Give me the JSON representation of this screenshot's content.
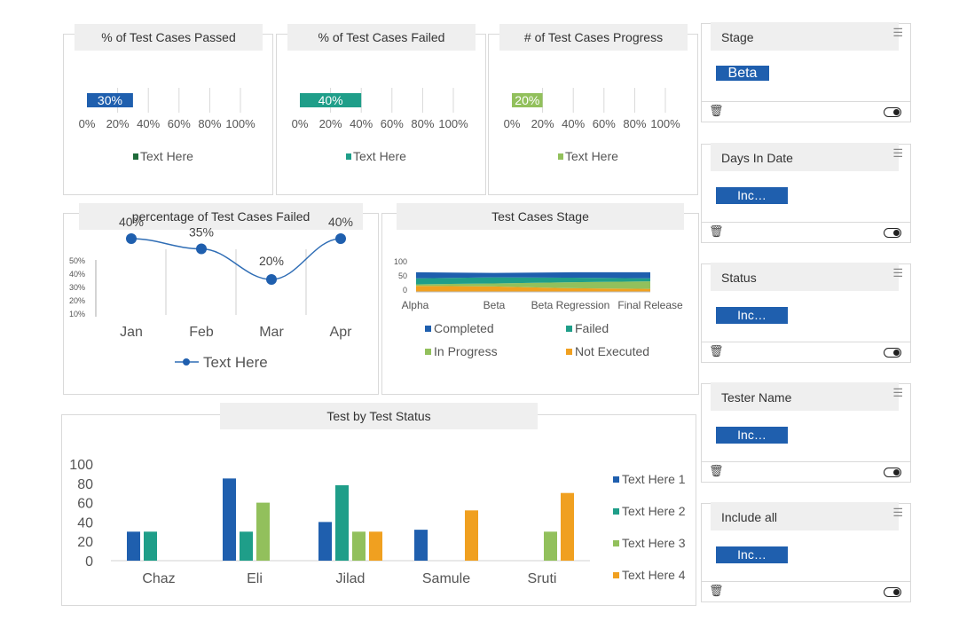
{
  "colors": {
    "blue": "#1f5fae",
    "teal": "#1f9e89",
    "lightgreen": "#92c05c",
    "orange": "#f0a020",
    "darkgreen": "#1f6b3a"
  },
  "kpi_panels": [
    {
      "title": "% of Test Cases Passed",
      "value_label": "30%",
      "value": 0.3,
      "color": "#1f5fae",
      "legend": "Text Here",
      "legend_color": "#1f6b3a"
    },
    {
      "title": "% of Test Cases Failed",
      "value_label": "40%",
      "value": 0.4,
      "color": "#1f9e89",
      "legend": "Text Here",
      "legend_color": "#1f9e89"
    },
    {
      "title": "# of Test Cases Progress",
      "value_label": "20%",
      "value": 0.2,
      "color": "#92c05c",
      "legend": "Text Here",
      "legend_color": "#92c05c"
    }
  ],
  "kpi_ticks": [
    "0%",
    "20%",
    "40%",
    "60%",
    "80%",
    "100%"
  ],
  "line_panel_title": "percentage of Test Cases Failed",
  "area_panel_title": "Test Cases Stage",
  "bar_panel_title": "Test by Test Status",
  "slicers": [
    {
      "title": "Stage",
      "chip": "Beta",
      "big": true
    },
    {
      "title": "Days In Date",
      "chip": "Inc…",
      "big": false
    },
    {
      "title": "Status",
      "chip": "Inc…",
      "big": false
    },
    {
      "title": "Tester Name",
      "chip": "Inc…",
      "big": false
    },
    {
      "title": "Include all",
      "chip": "Inc…",
      "big": false
    }
  ],
  "icons": {
    "menu": "menu-icon",
    "delete": "trash-icon",
    "toggle": "toggle-icon"
  },
  "chart_data": [
    {
      "type": "line",
      "title": "percentage of Test Cases Failed",
      "categories": [
        "Jan",
        "Feb",
        "Mar",
        "Apr"
      ],
      "series": [
        {
          "name": "Text Here",
          "values": [
            40,
            35,
            20,
            40
          ],
          "labels": [
            "40%",
            "35%",
            "20%",
            "40%"
          ]
        }
      ],
      "y_ticks": [
        "50%",
        "40%",
        "30%",
        "20%",
        "10%"
      ],
      "ylim": [
        10,
        50
      ]
    },
    {
      "type": "area",
      "title": "Test Cases Stage",
      "categories": [
        "Alpha",
        "Beta",
        "Beta Regression",
        "Final Release"
      ],
      "series": [
        {
          "name": "Not Executed",
          "color": "#f0a020",
          "values": [
            20,
            18,
            12,
            10
          ]
        },
        {
          "name": "In Progress",
          "color": "#92c05c",
          "values": [
            5,
            10,
            20,
            25
          ]
        },
        {
          "name": "Failed",
          "color": "#1f9e89",
          "values": [
            20,
            20,
            15,
            10
          ]
        },
        {
          "name": "Completed",
          "color": "#1f5fae",
          "values": [
            20,
            15,
            18,
            20
          ]
        }
      ],
      "legend_order": [
        "Completed",
        "Failed",
        "In Progress",
        "Not Executed"
      ],
      "y_ticks": [
        "100",
        "50",
        "0"
      ],
      "ylim": [
        0,
        100
      ]
    },
    {
      "type": "bar",
      "title": "Test by Test Status",
      "categories": [
        "Chaz",
        "Eli",
        "Jilad",
        "Samule",
        "Sruti"
      ],
      "series": [
        {
          "name": "Text Here 1",
          "color": "#1f5fae",
          "values": [
            30,
            85,
            40,
            32,
            0
          ]
        },
        {
          "name": "Text Here 2",
          "color": "#1f9e89",
          "values": [
            30,
            30,
            78,
            0,
            0
          ]
        },
        {
          "name": "Text Here 3",
          "color": "#92c05c",
          "values": [
            0,
            60,
            30,
            0,
            30
          ]
        },
        {
          "name": "Text Here 4",
          "color": "#f0a020",
          "values": [
            0,
            0,
            30,
            52,
            70
          ]
        }
      ],
      "y_ticks": [
        "100",
        "80",
        "60",
        "40",
        "20",
        "0"
      ],
      "ylim": [
        0,
        100
      ]
    }
  ]
}
